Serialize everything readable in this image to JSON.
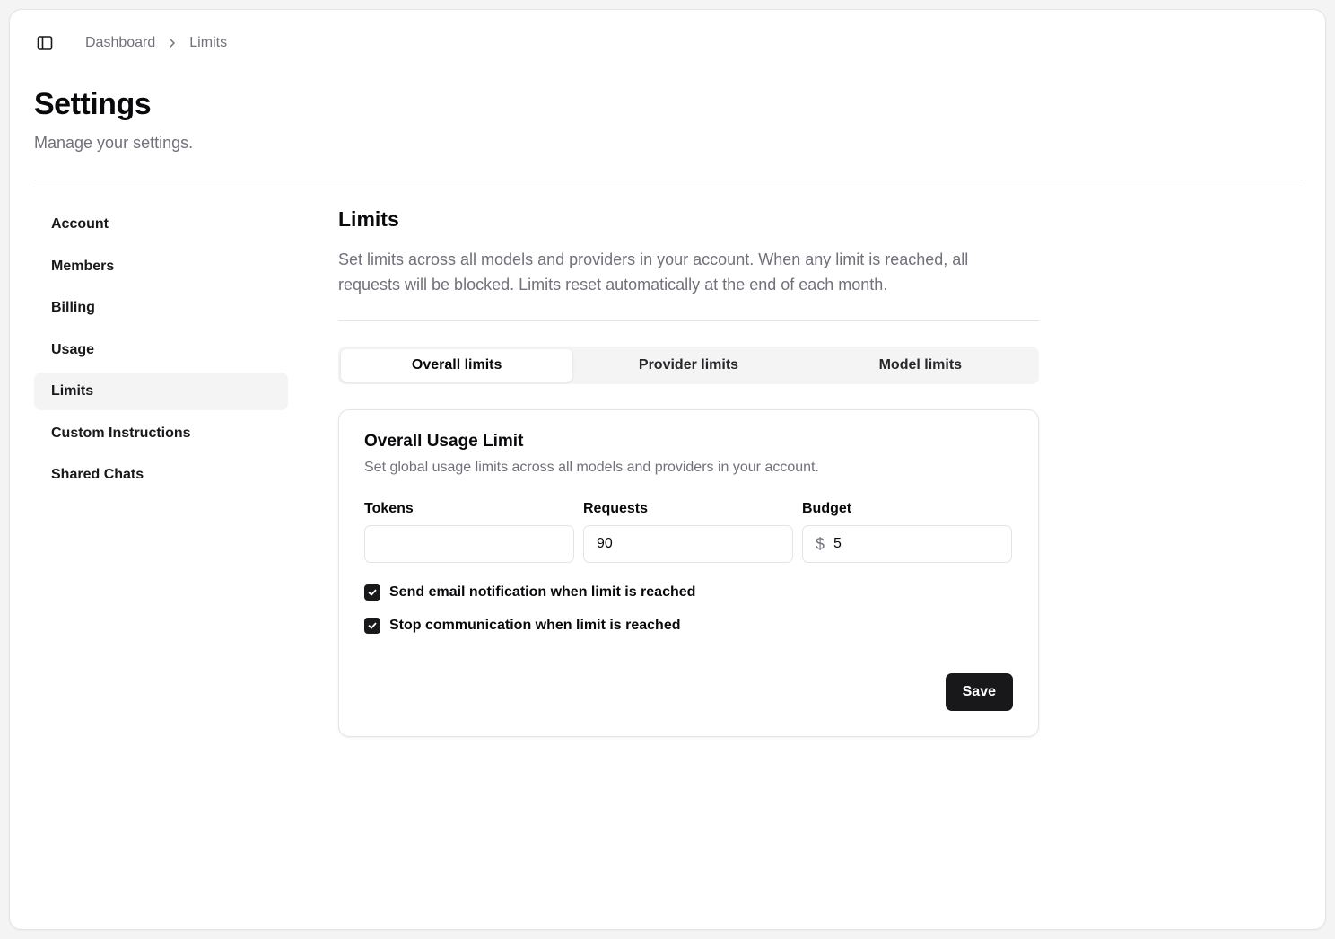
{
  "breadcrumb": {
    "items": [
      "Dashboard",
      "Limits"
    ]
  },
  "header": {
    "title": "Settings",
    "subtitle": "Manage your settings."
  },
  "sidebar": {
    "items": [
      {
        "label": "Account",
        "active": false
      },
      {
        "label": "Members",
        "active": false
      },
      {
        "label": "Billing",
        "active": false
      },
      {
        "label": "Usage",
        "active": false
      },
      {
        "label": "Limits",
        "active": true
      },
      {
        "label": "Custom Instructions",
        "active": false
      },
      {
        "label": "Shared Chats",
        "active": false
      }
    ]
  },
  "main": {
    "title": "Limits",
    "description": "Set limits across all models and providers in your account. When any limit is reached, all requests will be blocked. Limits reset automatically at the end of each month.",
    "tabs": [
      {
        "label": "Overall limits",
        "active": true
      },
      {
        "label": "Provider limits",
        "active": false
      },
      {
        "label": "Model limits",
        "active": false
      }
    ],
    "card": {
      "title": "Overall Usage Limit",
      "description": "Set global usage limits across all models and providers in your account.",
      "fields": {
        "tokens": {
          "label": "Tokens",
          "value": ""
        },
        "requests": {
          "label": "Requests",
          "value": "90"
        },
        "budget": {
          "label": "Budget",
          "prefix": "$",
          "value": "5"
        }
      },
      "checkboxes": [
        {
          "label": "Send email notification when limit is reached",
          "checked": true
        },
        {
          "label": "Stop communication when limit is reached",
          "checked": true
        }
      ],
      "save_label": "Save"
    }
  },
  "colors": {
    "primary": "#18181b",
    "muted_text": "#71717a",
    "border": "#e4e4e7",
    "active_bg": "#f4f4f5"
  },
  "icons": {
    "sidebar_toggle": "panel-left-icon",
    "breadcrumb_separator": "chevron-right-icon",
    "checkbox_mark": "check-icon"
  }
}
